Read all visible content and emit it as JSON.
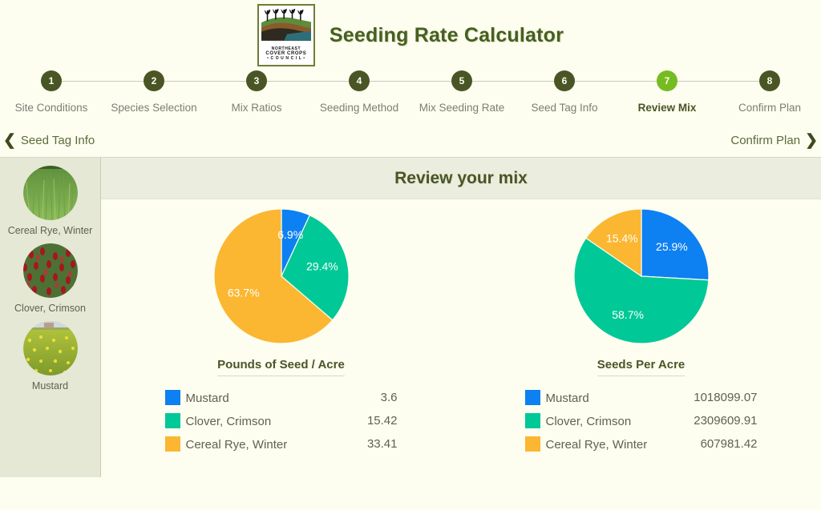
{
  "app": {
    "title": "Seeding Rate Calculator",
    "logo": {
      "line1": "NORTHEAST",
      "line2": "COVER CROPS",
      "line3": "• C O U N C I L •"
    }
  },
  "stepper": {
    "steps": [
      {
        "num": "1",
        "label": "Site Conditions",
        "active": false
      },
      {
        "num": "2",
        "label": "Species Selection",
        "active": false
      },
      {
        "num": "3",
        "label": "Mix Ratios",
        "active": false
      },
      {
        "num": "4",
        "label": "Seeding Method",
        "active": false
      },
      {
        "num": "5",
        "label": "Mix Seeding Rate",
        "active": false
      },
      {
        "num": "6",
        "label": "Seed Tag Info",
        "active": false
      },
      {
        "num": "7",
        "label": "Review Mix",
        "active": true
      },
      {
        "num": "8",
        "label": "Confirm Plan",
        "active": false
      }
    ]
  },
  "nav": {
    "prev_label": "Seed Tag Info",
    "prev_icon": "chevron-left-icon",
    "next_label": "Confirm Plan",
    "next_icon": "chevron-right-icon"
  },
  "sidebar": {
    "species": [
      {
        "name": "Cereal Rye, Winter",
        "image": "cereal-rye-photo"
      },
      {
        "name": "Clover, Crimson",
        "image": "crimson-clover-photo"
      },
      {
        "name": "Mustard",
        "image": "mustard-photo"
      }
    ]
  },
  "main": {
    "heading": "Review your mix"
  },
  "colors": {
    "mustard": "#0d80f2",
    "clover": "#00c896",
    "cereal_rye": "#fbb731",
    "accent_active": "#76bc21",
    "step_dark": "#4a5526",
    "page_bg": "#fdfdf0",
    "sidebar_bg": "#e4e8d4",
    "panel_header_bg": "#ebeede"
  },
  "chart_data": [
    {
      "type": "pie",
      "id": "pounds-per-acre",
      "title": "Pounds of Seed / Acre",
      "categories": [
        "Mustard",
        "Clover, Crimson",
        "Cereal Rye, Winter"
      ],
      "values": [
        3.6,
        15.42,
        33.41
      ],
      "value_labels": [
        "3.6",
        "15.42",
        "33.41"
      ],
      "percent_labels": [
        "6.9%",
        "29.4%",
        "63.7%"
      ],
      "percents": [
        6.9,
        29.4,
        63.7
      ],
      "colors": [
        "#0d80f2",
        "#00c896",
        "#fbb731"
      ],
      "legend_position": "below"
    },
    {
      "type": "pie",
      "id": "seeds-per-acre",
      "title": "Seeds Per Acre",
      "categories": [
        "Mustard",
        "Clover, Crimson",
        "Cereal Rye, Winter"
      ],
      "values": [
        1018099.07,
        2309609.91,
        607981.42
      ],
      "value_labels": [
        "1018099.07",
        "2309609.91",
        "607981.42"
      ],
      "percent_labels": [
        "25.9%",
        "58.7%",
        "15.4%"
      ],
      "percents": [
        25.9,
        58.7,
        15.4
      ],
      "colors": [
        "#0d80f2",
        "#00c896",
        "#fbb731"
      ],
      "legend_position": "below"
    }
  ]
}
